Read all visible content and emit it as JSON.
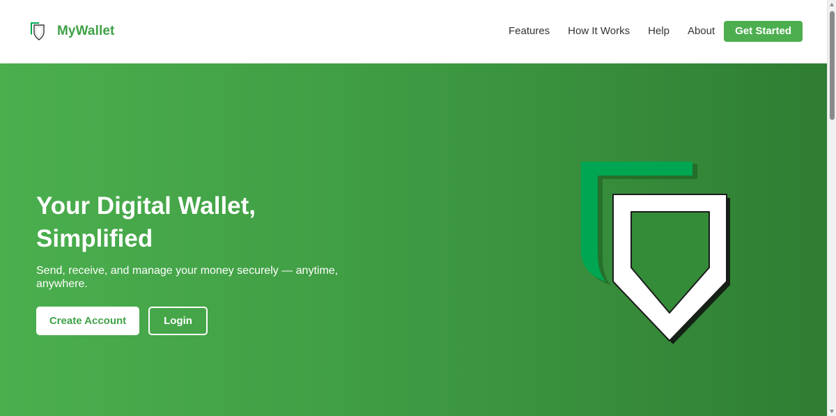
{
  "brand": {
    "name": "MyWallet",
    "logo_icon": "shield-icon",
    "color": "#3fa147"
  },
  "nav": {
    "items": [
      {
        "label": "Features"
      },
      {
        "label": "How It Works"
      },
      {
        "label": "Help"
      },
      {
        "label": "About"
      }
    ],
    "cta_label": "Get Started"
  },
  "hero": {
    "title_line1": "Your Digital Wallet,",
    "title_line2": "Simplified",
    "subtitle": "Send, receive, and manage your money securely — anytime, anywhere.",
    "primary_button": "Create Account",
    "secondary_button": "Login",
    "art_icon": "shield-icon",
    "gradient_start": "#4baf4e",
    "gradient_end": "#2f7d33"
  },
  "colors": {
    "accent": "#4cae4f",
    "art_green": "#00a651"
  }
}
